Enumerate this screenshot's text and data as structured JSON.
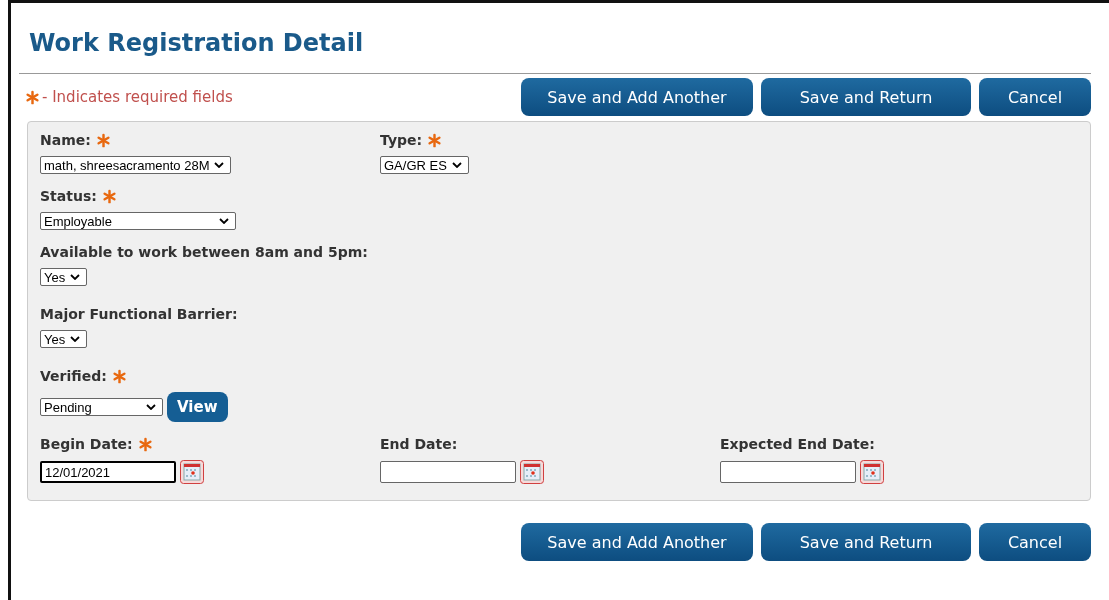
{
  "title": "Work Registration Detail",
  "required_note": "- Indicates required fields",
  "top_buttons": [
    "Save and Add Another",
    "Save and Return",
    "Cancel"
  ],
  "rows": [
    [
      {
        "kind": "select",
        "label": "Name:",
        "required": true,
        "value": "math, shreesacramento 28M"
      },
      {
        "kind": "select",
        "label": "Type:",
        "required": true,
        "value": "GA/GR ES"
      }
    ],
    [
      {
        "kind": "select",
        "label": "Status:",
        "required": true,
        "value": "Employable"
      }
    ],
    [
      {
        "kind": "select",
        "label": "Available to work between 8am and 5pm:",
        "required": false,
        "value": "Yes"
      }
    ],
    [
      {
        "kind": "select",
        "label": "Major Functional Barrier:",
        "required": false,
        "value": "Yes"
      }
    ],
    [
      {
        "kind": "select",
        "label": "Verified:",
        "required": true,
        "value": "Pending",
        "button": "View"
      }
    ],
    [
      {
        "kind": "date",
        "label": "Begin Date:",
        "required": true,
        "value": "12/01/2021",
        "focused": true
      },
      {
        "kind": "date",
        "label": "End Date:",
        "required": false,
        "focused": false
      },
      {
        "kind": "date",
        "label": "Expected End Date:",
        "required": false,
        "focused": false
      }
    ]
  ],
  "bottom_buttons": [
    "Save and Add Another",
    "Save and Return",
    "Cancel"
  ]
}
